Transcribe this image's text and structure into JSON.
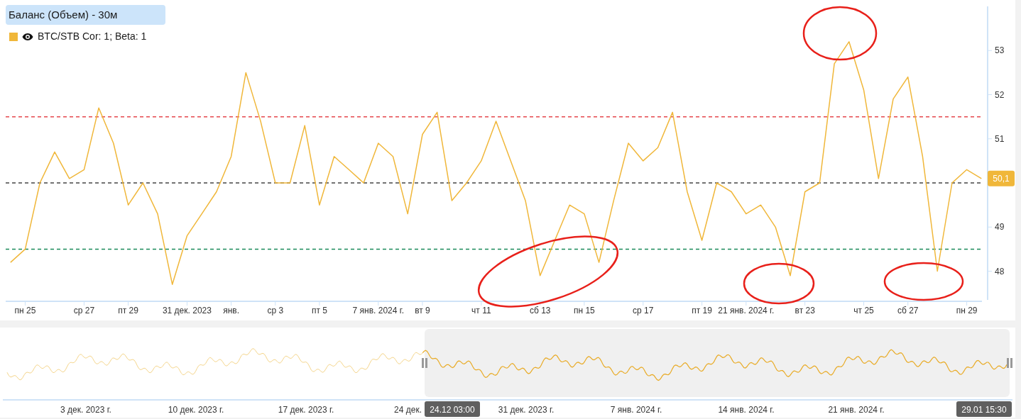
{
  "title": "Баланс (Объем) - 30м",
  "legend": [
    {
      "visible": true
    }
  ],
  "chart_data": {
    "type": "line",
    "categories": [
      null,
      "пн 25",
      null,
      null,
      null,
      "ср 27",
      null,
      null,
      "пт 29",
      null,
      null,
      null,
      "31 дек. 2023",
      null,
      null,
      "янв.",
      null,
      null,
      "ср 3",
      null,
      null,
      "пт 5",
      null,
      null,
      null,
      "7 янв. 2024 г.",
      null,
      null,
      "вт 9",
      null,
      null,
      null,
      "чт 11",
      null,
      null,
      null,
      "сб 13",
      null,
      null,
      "пн 15",
      null,
      null,
      null,
      "ср 17",
      null,
      null,
      null,
      "пт 19",
      null,
      null,
      "21 янв. 2024 г.",
      null,
      null,
      null,
      "вт 23",
      null,
      null,
      null,
      "чт 25",
      null,
      null,
      "сб 27",
      null,
      null,
      null,
      "пн 29",
      null
    ],
    "series": [
      {
        "name": "BTC/STB Cor: 1; Beta: 1",
        "color": "#f0b73a",
        "values": [
          48.2,
          48.5,
          50.0,
          50.7,
          50.1,
          50.3,
          51.7,
          50.9,
          49.5,
          50.0,
          49.3,
          47.7,
          48.8,
          49.3,
          49.8,
          50.6,
          52.5,
          51.4,
          50.0,
          50.0,
          51.3,
          49.5,
          50.6,
          50.3,
          50.0,
          50.9,
          50.6,
          49.3,
          51.1,
          51.6,
          49.6,
          50.0,
          50.5,
          51.4,
          50.5,
          49.6,
          47.9,
          48.7,
          49.5,
          49.3,
          48.2,
          49.6,
          50.9,
          50.5,
          50.8,
          51.6,
          49.8,
          48.7,
          50.0,
          49.8,
          49.3,
          49.5,
          49.0,
          47.9,
          49.8,
          50.0,
          52.7,
          53.2,
          52.1,
          50.1,
          51.9,
          52.4,
          50.6,
          48.0,
          50.0,
          50.3,
          50.1
        ]
      }
    ],
    "ylim": [
      47.35,
      54.0
    ],
    "yticks": [
      48,
      49,
      51,
      52,
      53
    ],
    "ref_lines": [
      {
        "axis": "y",
        "value": 51.5,
        "color": "#e5484d"
      },
      {
        "axis": "y",
        "value": 50,
        "color": "#444444"
      },
      {
        "axis": "y",
        "value": 48.5,
        "color": "#1a8a5a"
      }
    ]
  },
  "highlights": [
    {
      "kind": "ellipse"
    },
    {
      "kind": "ellipse"
    },
    {
      "kind": "ellipse"
    },
    {
      "kind": "ellipse"
    }
  ],
  "last_value": "50,1",
  "navigator": {
    "axis_labels": [
      "3 дек. 2023 г.",
      "10 дек. 2023 г.",
      "17 дек. 2023 г.",
      "24 дек.",
      "31 дек. 2023 г.",
      "7 янв. 2024 г.",
      "14 янв. 2024 г.",
      "21 янв. 2024 г."
    ],
    "range_start": "24.12 03:00",
    "range_end": "29.01 15:30"
  }
}
